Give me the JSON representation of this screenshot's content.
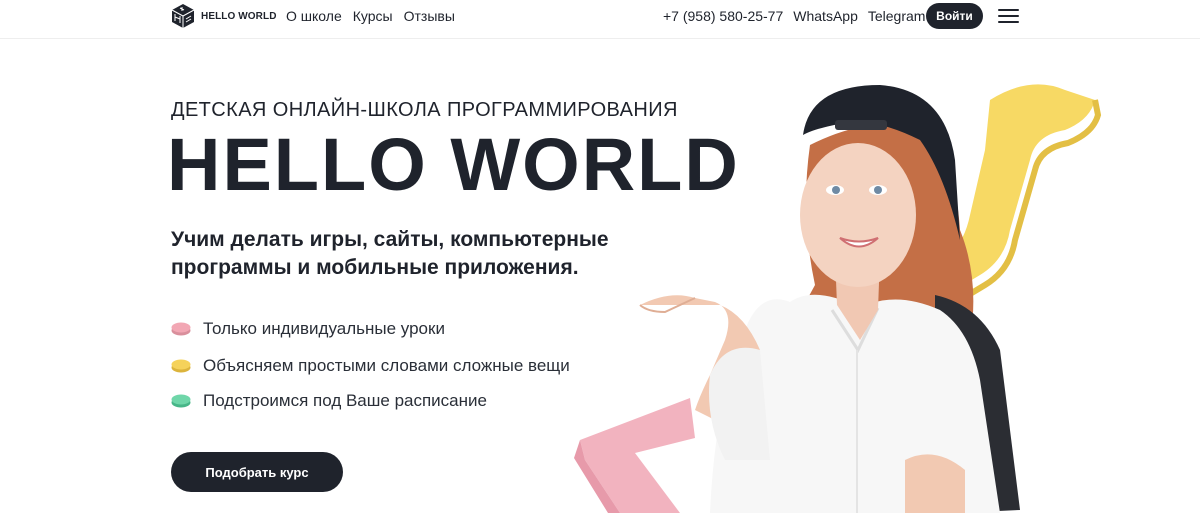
{
  "header": {
    "logo_text": "HELLO WORLD",
    "nav": [
      "О школе",
      "Курсы",
      "Отзывы"
    ],
    "phone": "+7 (958) 580-25-77",
    "whatsapp": "WhatsApp",
    "telegram": "Telegram",
    "login_label": "Войти",
    "menu_icon": "hamburger-icon"
  },
  "hero": {
    "subtitle": "ДЕТСКАЯ ОНЛАЙН-ШКОЛА ПРОГРАММИРОВАНИЯ",
    "title": "HELLO WORLD",
    "lead": "Учим делать игры, сайты, компьютерные программы и мобильные приложения.",
    "features": [
      {
        "text": "Только индивидуальные уроки",
        "color": "#f2a7b4"
      },
      {
        "text": "Объясняем простыми словами сложные вещи",
        "color": "#f5d25a"
      },
      {
        "text": "Подстроимся под Ваше расписание",
        "color": "#6fd6a9"
      }
    ],
    "cta_label": "Подобрать курс"
  },
  "colors": {
    "dark": "#1f232c",
    "accent_yellow": "#f7d964",
    "accent_pink": "#f2b3bf"
  }
}
